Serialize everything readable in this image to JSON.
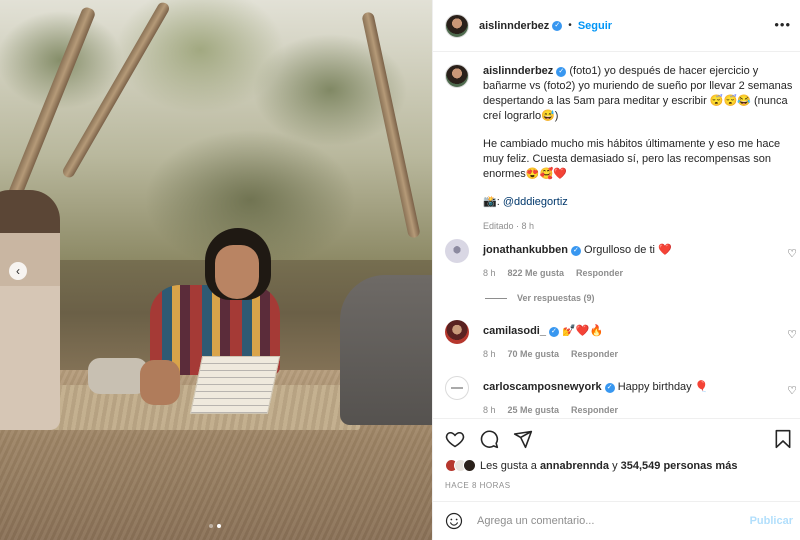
{
  "post": {
    "author": "aislinnderbez",
    "follow_label": "Seguir",
    "more_icon": "more-options-icon"
  },
  "caption": {
    "author": "aislinnderbez",
    "text1": "(foto1) yo después de hacer ejercicio y bañarme vs (foto2) yo muriendo de sueño por llevar 2 semanas despertando a las 5am para meditar y escribir 😴😴😂 (nunca creí lograrlo😅)",
    "text2": "He cambiado mucho mis hábitos últimamente y eso me hace muy feliz. Cuesta demasiado sí, pero las recompensas son enormes😍🥰❤️",
    "credit_prefix": "📸: ",
    "credit_mention": "@dddiegortiz",
    "edited": "Editado · 8 h"
  },
  "comments": [
    {
      "user": "jonathankubben",
      "text": "Orgulloso de ti ❤️",
      "time": "8 h",
      "likes": "822 Me gusta",
      "reply": "Responder",
      "view_replies": "Ver respuestas (9)"
    },
    {
      "user": "camilasodi_",
      "text": "💅❤️🔥",
      "time": "8 h",
      "likes": "70 Me gusta",
      "reply": "Responder"
    },
    {
      "user": "carloscamposnewyork",
      "text": "Happy birthday 🎈",
      "time": "8 h",
      "likes": "25 Me gusta",
      "reply": "Responder"
    }
  ],
  "likes": {
    "prefix": "Les gusta a ",
    "user": "annabrennda",
    "middle": " y ",
    "count": "354,549 personas más"
  },
  "timestamp": "HACE 8 HORAS",
  "add_comment": {
    "placeholder": "Agrega un comentario...",
    "post_label": "Publicar"
  },
  "carousel": {
    "current": 2,
    "total": 2
  },
  "colors": {
    "accent": "#0095f6",
    "verified": "#3897f0",
    "muted": "#8e8e8e",
    "text": "#262626"
  }
}
